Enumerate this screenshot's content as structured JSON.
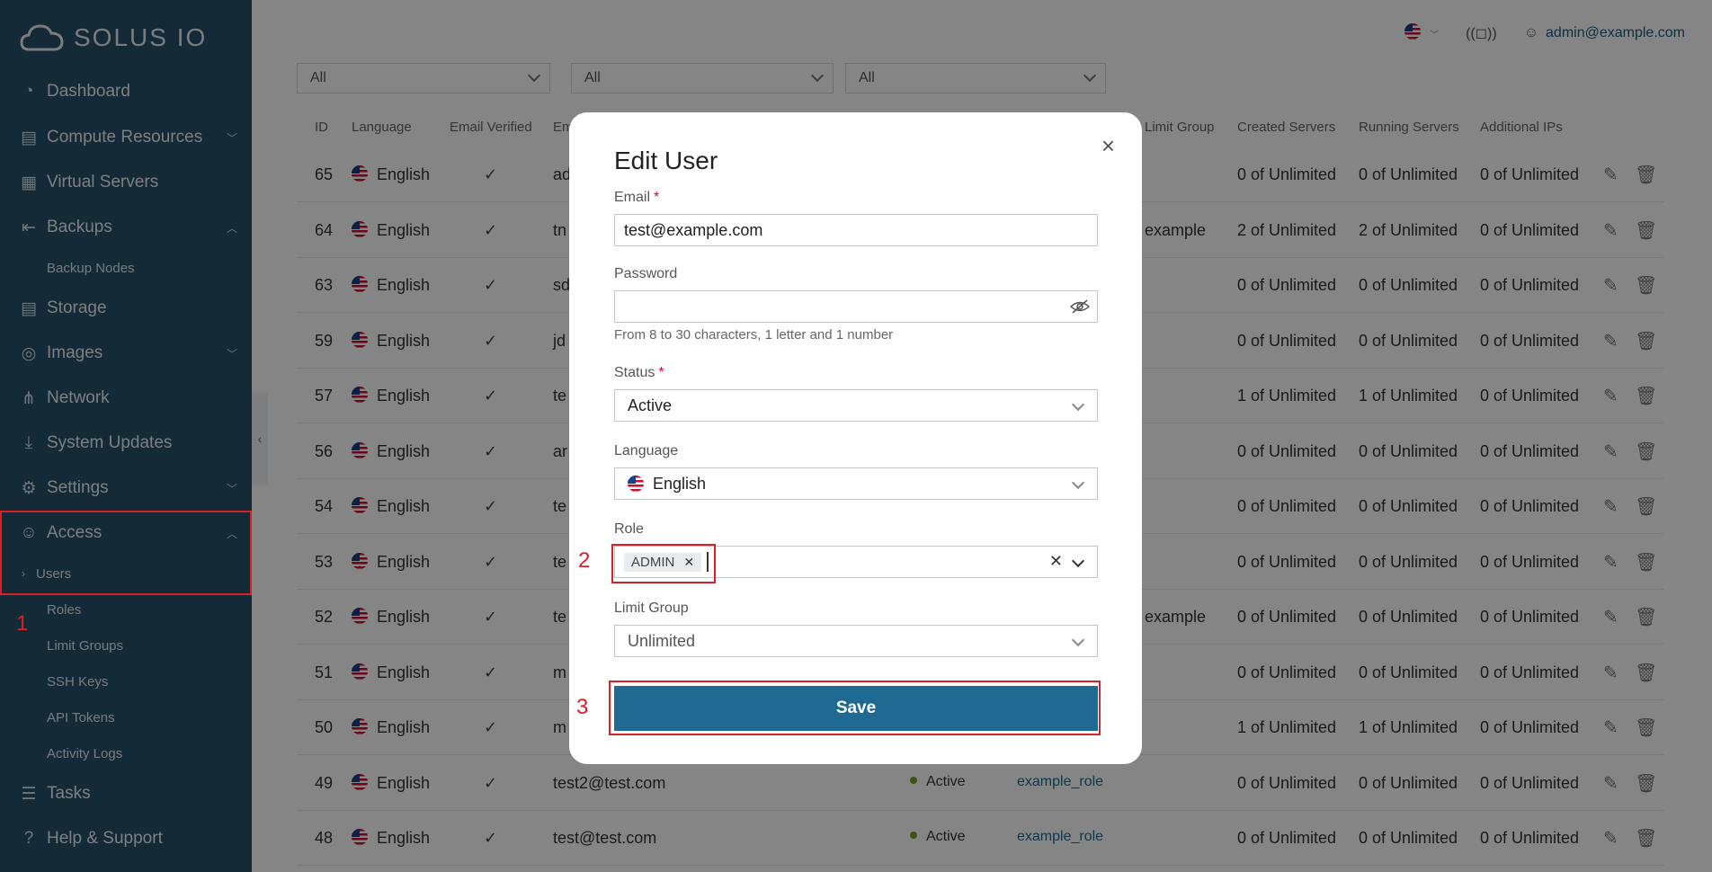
{
  "app": {
    "brand": "SOLUS IO"
  },
  "sidebar": {
    "items": [
      {
        "label": "Dashboard"
      },
      {
        "label": "Compute Resources"
      },
      {
        "label": "Virtual Servers"
      },
      {
        "label": "Backups"
      },
      {
        "label": "Storage"
      },
      {
        "label": "Images"
      },
      {
        "label": "Network"
      },
      {
        "label": "System Updates"
      },
      {
        "label": "Settings"
      },
      {
        "label": "Access"
      },
      {
        "label": "Tasks"
      },
      {
        "label": "Help & Support"
      }
    ],
    "backups_sub": [
      "Backup Nodes"
    ],
    "access_sub": [
      "Users",
      "Roles",
      "Limit Groups",
      "SSH Keys",
      "API Tokens",
      "Activity Logs"
    ]
  },
  "topbar": {
    "user": "admin@example.com"
  },
  "filters": [
    "All",
    "All",
    "All"
  ],
  "table": {
    "headers": [
      "ID",
      "Language",
      "Email Verified",
      "Em",
      "Limit Group",
      "Created Servers",
      "Running Servers",
      "Additional IPs"
    ],
    "rows": [
      {
        "id": "65",
        "lang": "English",
        "email": "ad",
        "limit": "",
        "created": "0 of Unlimited",
        "running": "0 of Unlimited",
        "ips": "0 of Unlimited"
      },
      {
        "id": "64",
        "lang": "English",
        "email": "tn",
        "limit": "example",
        "created": "2 of Unlimited",
        "running": "2 of Unlimited",
        "ips": "0 of Unlimited"
      },
      {
        "id": "63",
        "lang": "English",
        "email": "sd",
        "limit": "",
        "created": "0 of Unlimited",
        "running": "0 of Unlimited",
        "ips": "0 of Unlimited"
      },
      {
        "id": "59",
        "lang": "English",
        "email": "jd",
        "limit": "",
        "created": "0 of Unlimited",
        "running": "0 of Unlimited",
        "ips": "0 of Unlimited"
      },
      {
        "id": "57",
        "lang": "English",
        "email": "te",
        "limit": "",
        "created": "1 of Unlimited",
        "running": "1 of Unlimited",
        "ips": "0 of Unlimited"
      },
      {
        "id": "56",
        "lang": "English",
        "email": "ar",
        "limit": "",
        "created": "0 of Unlimited",
        "running": "0 of Unlimited",
        "ips": "0 of Unlimited"
      },
      {
        "id": "54",
        "lang": "English",
        "email": "te",
        "limit": "",
        "created": "0 of Unlimited",
        "running": "0 of Unlimited",
        "ips": "0 of Unlimited"
      },
      {
        "id": "53",
        "lang": "English",
        "email": "te",
        "limit": "",
        "created": "0 of Unlimited",
        "running": "0 of Unlimited",
        "ips": "0 of Unlimited"
      },
      {
        "id": "52",
        "lang": "English",
        "email": "te",
        "limit": "example",
        "created": "0 of Unlimited",
        "running": "0 of Unlimited",
        "ips": "0 of Unlimited"
      },
      {
        "id": "51",
        "lang": "English",
        "email": "m",
        "limit": "",
        "created": "0 of Unlimited",
        "running": "0 of Unlimited",
        "ips": "0 of Unlimited"
      },
      {
        "id": "50",
        "lang": "English",
        "email": "m",
        "limit": "",
        "created": "1 of Unlimited",
        "running": "1 of Unlimited",
        "ips": "0 of Unlimited"
      },
      {
        "id": "49",
        "lang": "English",
        "email": "test2@test.com",
        "status": "Active",
        "role": "example_role",
        "created": "0 of Unlimited",
        "running": "0 of Unlimited",
        "ips": "0 of Unlimited"
      },
      {
        "id": "48",
        "lang": "English",
        "email": "test@test.com",
        "status": "Active",
        "role": "example_role",
        "created": "0 of Unlimited",
        "running": "0 of Unlimited",
        "ips": "0 of Unlimited"
      }
    ]
  },
  "modal": {
    "title": "Edit User",
    "email_label": "Email",
    "email_value": "test@example.com",
    "password_label": "Password",
    "password_hint": "From 8 to 30 characters, 1 letter and 1 number",
    "status_label": "Status",
    "status_value": "Active",
    "language_label": "Language",
    "language_value": "English",
    "role_label": "Role",
    "role_chip": "ADMIN",
    "limit_label": "Limit Group",
    "limit_value": "Unlimited",
    "save_label": "Save",
    "close_glyph": "×",
    "required_mark": "*"
  },
  "markers": [
    "1",
    "2",
    "3"
  ],
  "colors": {
    "sidebar": "#28526a",
    "accent": "#1f6a92",
    "highlight": "#d72027",
    "active_dot": "#7a9f2a"
  }
}
